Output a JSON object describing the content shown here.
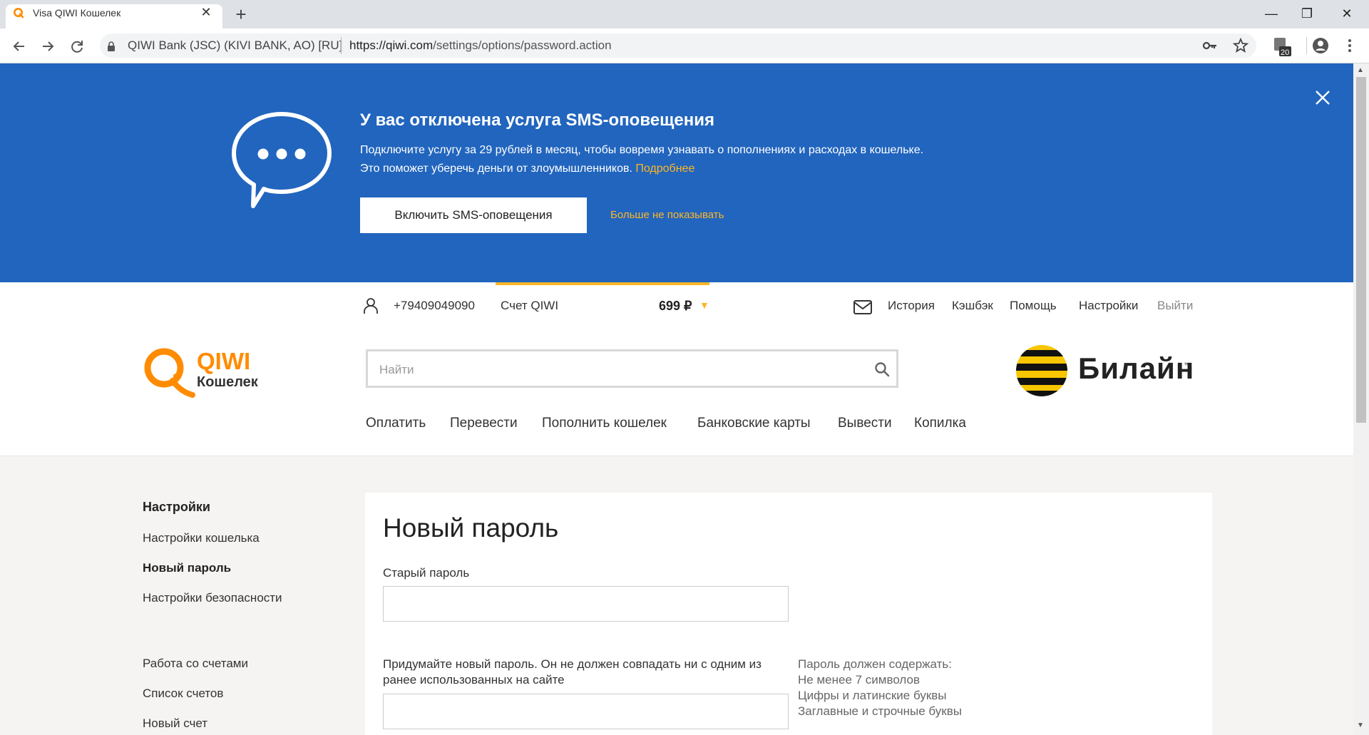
{
  "browser": {
    "tab_title": "Visa QIWI Кошелек",
    "tab_close": "✕",
    "new_tab": "+",
    "site_identity": "QIWI Bank (JSC) (KIVI BANK, AO) [RU]",
    "url_domain": "https://qiwi.com",
    "url_path": "/settings/options/password.action",
    "extension_badge": "20",
    "window_minimize": "—",
    "window_restore": "❐",
    "window_close": "✕",
    "icons": [
      "back-arrow-icon",
      "forward-arrow-icon",
      "reload-icon",
      "lock-icon",
      "key-icon",
      "star-icon",
      "extension-icon",
      "profile-icon",
      "kebab-menu-icon"
    ]
  },
  "banner": {
    "title": "У вас отключена услуга SMS-оповещения",
    "text_line1": "Подключите услугу за 29 рублей в месяц, чтобы вовремя узнавать о пополнениях и расходах в кошельке.",
    "text_line2": "Это поможет уберечь деньги от злоумышленников.",
    "more_link": "Подробнее",
    "enable_button": "Включить SMS-оповещения",
    "dont_show_link": "Больше не показывать",
    "background_color": "#2165be",
    "accent_color": "#ffb627"
  },
  "header": {
    "phone": "+79409049090",
    "account_label": "Счет QIWI",
    "balance": "699 ₽",
    "balance_caret": "▼",
    "links": {
      "history": "История",
      "cashback": "Кэшбэк",
      "help": "Помощь",
      "settings": "Настройки",
      "logout": "Выйти"
    },
    "logo_title": "QIWI",
    "logo_subtitle": "Кошелек",
    "search_placeholder": "Найти",
    "partner_name": "Билайн",
    "partner_tm": "™",
    "nav": {
      "pay": "Оплатить",
      "transfer": "Перевести",
      "topup": "Пополнить кошелек",
      "cards": "Банковские карты",
      "withdraw": "Вывести",
      "piggy": "Копилка"
    }
  },
  "sidebar": {
    "title": "Настройки",
    "items": [
      "Настройки кошелька",
      "Новый пароль",
      "Настройки безопасности",
      "Работа со счетами",
      "Список счетов",
      "Новый счет"
    ],
    "active": "Новый пароль"
  },
  "form": {
    "title": "Новый пароль",
    "old_password_label": "Старый пароль",
    "new_password_label": "Придумайте новый пароль. Он не должен совпадать ни с одним из ранее использованных на сайте",
    "rules": [
      "Пароль должен содержать:",
      "Не менее 7 символов",
      "Цифры и латинские буквы",
      "Заглавные и строчные буквы"
    ]
  }
}
